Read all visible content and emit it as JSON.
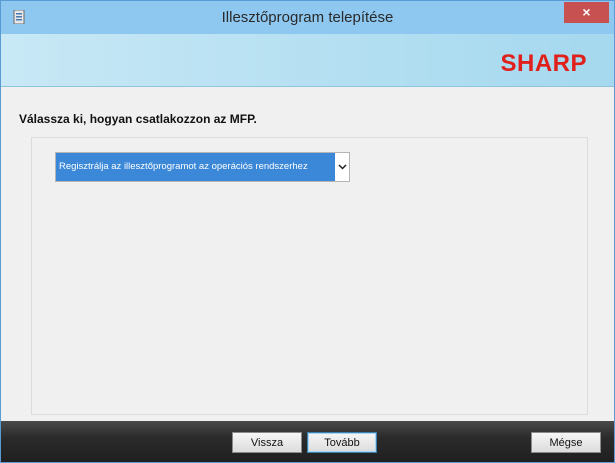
{
  "window": {
    "title": "Illesztőprogram telepítése",
    "close_label": "×"
  },
  "banner": {
    "brand": "SHARP"
  },
  "main": {
    "instruction": "Válassza ki, hogyan csatlakozzon az MFP.",
    "connection_select": {
      "selected": "Regisztrálja az illesztőprogramot az operációs rendszerhez"
    }
  },
  "footer": {
    "back_label": "Vissza",
    "next_label": "Tovább",
    "cancel_label": "Mégse"
  },
  "colors": {
    "titlebar": "#8ec8f0",
    "close_button": "#c75050",
    "brand_red": "#e0201b",
    "selection": "#3b88d8"
  }
}
